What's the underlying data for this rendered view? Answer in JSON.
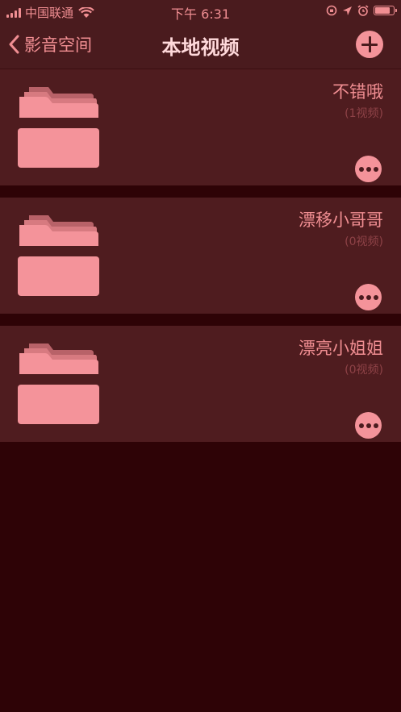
{
  "status_bar": {
    "carrier": "中国联通",
    "time": "下午 6:31"
  },
  "nav": {
    "back_label": "影音空间",
    "title": "本地视频"
  },
  "colors": {
    "background": "#2e0306",
    "bar": "#4a1b1e",
    "row": "#4f1c1f",
    "accent": "#f4939a",
    "muted": "#8e4247"
  },
  "folders": [
    {
      "name": "不错哦",
      "count": "(1视频)"
    },
    {
      "name": "漂移小哥哥",
      "count": "(0视频)"
    },
    {
      "name": "漂亮小姐姐",
      "count": "(0视频)"
    }
  ]
}
